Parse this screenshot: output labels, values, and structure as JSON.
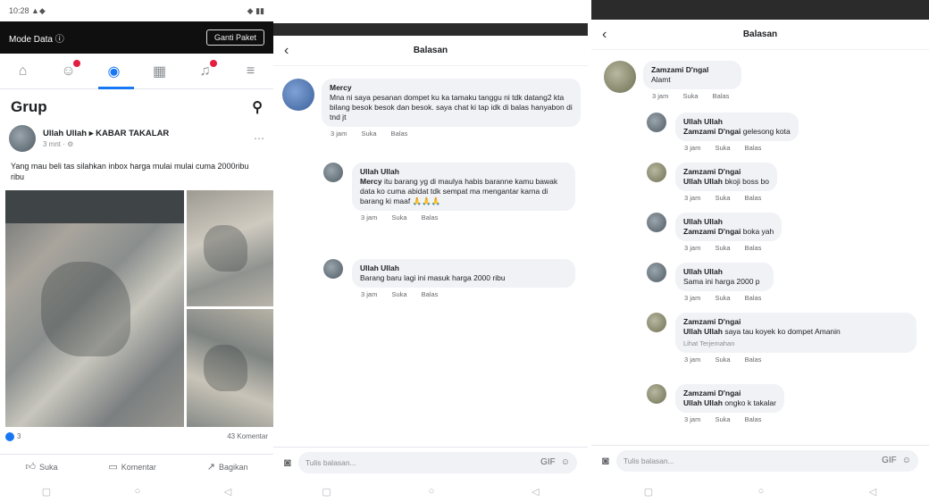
{
  "screen1": {
    "status": {
      "left": "10:28 ▲◆",
      "right": "◆ ▮▮"
    },
    "banner": {
      "left": "Mode Data ⓘ",
      "button": "Ganti Paket"
    },
    "nav_icons": [
      "home-icon",
      "friends-icon",
      "groups-icon",
      "marketplace-icon",
      "notifications-icon",
      "menu-icon"
    ],
    "header_title": "Grup",
    "post": {
      "author": "Ullah Ullah ▸ KABAR TAKALAR",
      "time": "3 mnt · ⚙",
      "text": "Yang mau beli tas silahkan inbox harga mulai mulai cuma 2000ribu ribu"
    },
    "reactions": {
      "left": "3",
      "right": "43 Komentar"
    },
    "actions": [
      "Suka",
      "Komentar",
      "Bagikan"
    ],
    "colors": {
      "accent": "#1877f2",
      "badge": "#e41e3f"
    }
  },
  "screen2": {
    "title": "Balasan",
    "comments": [
      {
        "name": "Mercy",
        "text": "Mna ni saya pesanan dompet ku ka tamaku tanggu ni tdk datang2 kta bilang besok besok dan besok. saya chat ki tap idk di balas hanyabon di tnd jt",
        "meta": [
          "3 jam",
          "Suka",
          "Balas"
        ]
      },
      {
        "name": "Ullah Ullah",
        "mention": "Mercy",
        "text": "itu barang yg di maulya habis baranne kamu bawak data ko cuma abidat tdk sempat ma mengantar karna di barang ki maaf 🙏🙏🙏",
        "meta": [
          "3 jam",
          "Suka",
          "Balas"
        ]
      },
      {
        "name": "Ullah Ullah",
        "text": "Barang baru lagi ini masuk harga 2000 ribu",
        "meta": [
          "3 jam",
          "Suka",
          "Balas"
        ]
      }
    ],
    "input_placeholder": "Tulis balasan..."
  },
  "screen3": {
    "title": "Balasan",
    "comments": [
      {
        "name": "Zamzami D'ngal",
        "text": "Alamt",
        "meta": [
          "3 jam",
          "Suka",
          "Balas"
        ]
      },
      {
        "name": "Ullah Ullah",
        "mention": "Zamzami D'ngai",
        "text": "gelesong kota",
        "meta": [
          "3 jam",
          "Suka",
          "Balas"
        ]
      },
      {
        "name": "Zamzami D'ngai",
        "mention": "Ullah Ullah",
        "text": "bkoji boss bo",
        "meta": [
          "3 jam",
          "Suka",
          "Balas"
        ]
      },
      {
        "name": "Ullah Ullah",
        "mention": "Zamzami D'ngai",
        "text": "boka yah",
        "meta": [
          "3 jam",
          "Suka",
          "Balas"
        ]
      },
      {
        "name": "Ullah Ullah",
        "text": "Sama ini harga 2000 p",
        "meta": [
          "3 jam",
          "Suka",
          "Balas"
        ]
      },
      {
        "name": "Zamzami D'ngai",
        "mention": "Ullah Ullah",
        "text": "saya tau koyek ko dompet Amanin",
        "seeall": "Lihat Terjemahan",
        "meta": [
          "3 jam",
          "Suka",
          "Balas"
        ]
      },
      {
        "name": "Zamzami D'ngai",
        "mention": "Ullah Ullah",
        "text": "ongko k takalar",
        "meta": [
          "3 jam",
          "Suka",
          "Balas"
        ]
      }
    ],
    "input_placeholder": "Tulis balasan..."
  }
}
